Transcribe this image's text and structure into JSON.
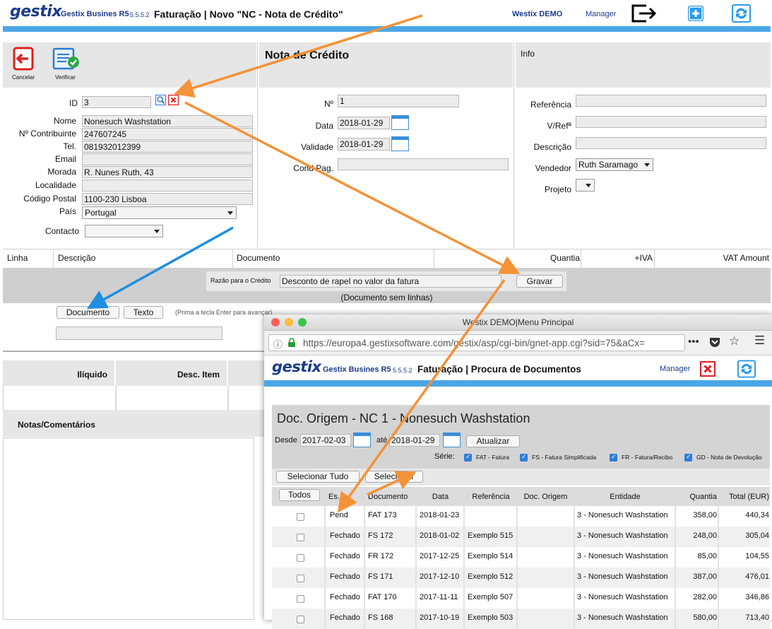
{
  "header": {
    "logo": "gestix",
    "app_name": "Gestix Busines R5",
    "version": "5.5.5.2",
    "title": "Faturação | Novo \"NC - Nota de Crédito\"",
    "company": "Westix DEMO",
    "user": "Manager"
  },
  "toolbar": {
    "cancel_label": "Cancelar",
    "verify_label": "Verificar"
  },
  "client": {
    "id_label": "ID",
    "id_value": "3",
    "name_label": "Nome",
    "name_value": "Nonesuch Washstation",
    "tax_label": "Nº Contribuinte",
    "tax_value": "247607245",
    "tel_label": "Tel.",
    "tel_value": "081932012399",
    "email_label": "Email",
    "email_value": "",
    "address_label": "Morada",
    "address_value": "R. Nunes Ruth, 43",
    "locality_label": "Localidade",
    "locality_value": "",
    "postal_label": "Código Postal",
    "postal_value": "1100-230 Lisboa",
    "country_label": "País",
    "country_value": "Portugal",
    "contact_label": "Contacto",
    "contact_value": ""
  },
  "doc": {
    "heading": "Nota de Crédito",
    "num_label": "Nº",
    "num_value": "1",
    "date_label": "Data",
    "date_value": "2018-01-29",
    "validity_label": "Validade",
    "validity_value": "2018-01-29",
    "payment_label": "Cond Pag.",
    "payment_value": ""
  },
  "info": {
    "heading": "Info",
    "ref_label": "Referência",
    "yref_label": "V/Refª",
    "desc_label": "Descrição",
    "seller_label": "Vendedor",
    "seller_value": "Ruth Saramago",
    "project_label": "Projeto"
  },
  "lines": {
    "col_line": "Linha",
    "col_desc": "Descrição",
    "col_doc": "Documento",
    "col_qty": "Quantia",
    "col_vat": "+IVA",
    "col_vat_amount": "VAT Amount",
    "reason_label": "Razão para o Crédito",
    "reason_value": "Desconto de rapel no valor da fatura",
    "save_label": "Gravar",
    "no_lines": "(Documento sem linhas)",
    "tab_doc": "Documento",
    "tab_text": "Texto",
    "hint": "(Prima a tecla Enter para avançar)"
  },
  "totals": {
    "net_label": "Ilíquido",
    "discount_label": "Desc. Item",
    "notes_label": "Notas/Comentários"
  },
  "popup": {
    "window_title": "Westix DEMO|Menu Principal",
    "url": "https://europa4.gestixsoftware.com/gestix/asp/cgi-bin/gnet-app.cgi?sid=75&aCx=",
    "app_name": "Gestix Busines R5",
    "version": "5.5.5.2",
    "title": "Faturação | Procura de Documentos",
    "user": "Manager",
    "heading": "Doc. Origem - NC 1 - Nonesuch Washstation",
    "from_label": "Desde",
    "from_value": "2017-02-03",
    "to_label": "até",
    "to_value": "2018-01-29",
    "refresh_label": "Atualizar",
    "series_label": "Série:",
    "series": [
      {
        "label": "FAT - Fatura",
        "checked": true
      },
      {
        "label": "FS - Fatura Simplificada",
        "checked": true
      },
      {
        "label": "FR - Fatura/Recibo",
        "checked": true
      },
      {
        "label": "GD - Nota de Devolução",
        "checked": true
      }
    ],
    "select_all_label": "Selecionar Tudo",
    "select_label": "Selecionar",
    "all_label": "Todos",
    "columns": [
      "Es.",
      "Documento",
      "Data",
      "Referência",
      "Doc. Origem",
      "Entidade",
      "Quantia",
      "Total (EUR)"
    ],
    "rows": [
      {
        "status": "Pend",
        "doc": "FAT 173",
        "date": "2018-01-23",
        "ref": "",
        "origin": "",
        "entity": "3 - Nonesuch Washstation",
        "qty": "358,00",
        "total": "440,34"
      },
      {
        "status": "Fechado",
        "doc": "FS 172",
        "date": "2018-01-02",
        "ref": "Exemplo 515",
        "origin": "",
        "entity": "3 - Nonesuch Washstation",
        "qty": "248,00",
        "total": "305,04"
      },
      {
        "status": "Fechado",
        "doc": "FR 172",
        "date": "2017-12-25",
        "ref": "Exemplo 514",
        "origin": "",
        "entity": "3 - Nonesuch Washstation",
        "qty": "85,00",
        "total": "104,55"
      },
      {
        "status": "Fechado",
        "doc": "FS 171",
        "date": "2017-12-10",
        "ref": "Exemplo 512",
        "origin": "",
        "entity": "3 - Nonesuch Washstation",
        "qty": "387,00",
        "total": "476,01"
      },
      {
        "status": "Fechado",
        "doc": "FAT 170",
        "date": "2017-11-11",
        "ref": "Exemplo 507",
        "origin": "",
        "entity": "3 - Nonesuch Washstation",
        "qty": "282,00",
        "total": "346,86"
      },
      {
        "status": "Fechado",
        "doc": "FS 168",
        "date": "2017-10-19",
        "ref": "Exemplo 503",
        "origin": "",
        "entity": "3 - Nonesuch Washstation",
        "qty": "580,00",
        "total": "713,40"
      }
    ]
  },
  "colors": {
    "brand": "#1b3b8a",
    "accent_blue": "#4aa6e6",
    "annotation_orange": "#f39236",
    "annotation_blue": "#1e8ee0",
    "danger_red": "#e02020"
  }
}
